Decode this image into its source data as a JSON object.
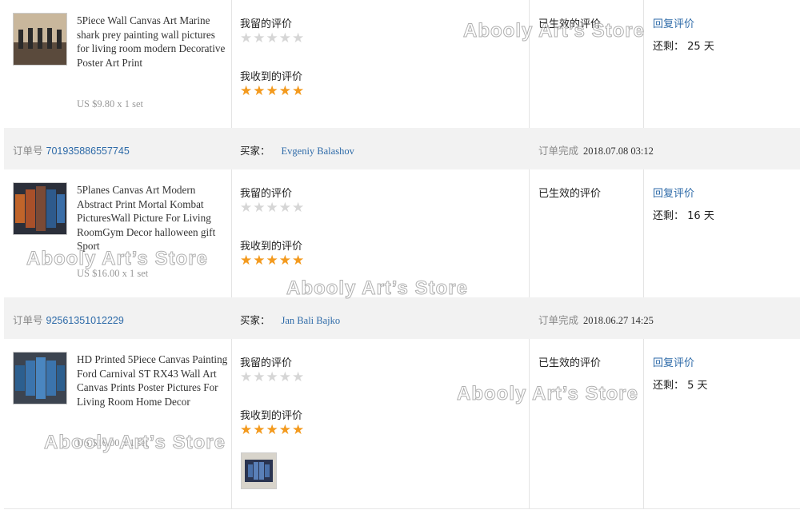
{
  "items": [
    {
      "title": "5Piece Wall Canvas Art Marine shark prey painting wall pictures for living room modern Decorative Poster Art Print",
      "price": "US $9.80 x 1 set",
      "my_review_label": "我留的评价",
      "my_stars": 0,
      "received_review_label": "我收到的评价",
      "received_stars": 5,
      "effective_label": "已生效的评价",
      "reply_label": "回复评价",
      "remaining_label": "还剩：",
      "remaining_value": "25 天"
    },
    {
      "title": "5Planes Canvas Art Modern Abstract Print Mortal Kombat PicturesWall Picture For Living RoomGym Decor halloween gift Sport",
      "price": "US $16.00 x 1 set",
      "my_review_label": "我留的评价",
      "my_stars": 0,
      "received_review_label": "我收到的评价",
      "received_stars": 5,
      "effective_label": "已生效的评价",
      "reply_label": "回复评价",
      "remaining_label": "还剩：",
      "remaining_value": "16 天"
    },
    {
      "title": "HD Printed 5Piece Canvas Painting Ford Carnival ST RX43 Wall Art Canvas Prints Poster Pictures For Living Room Home Decor",
      "price": "US $16.00 x 1 set",
      "my_review_label": "我留的评价",
      "my_stars": 0,
      "received_review_label": "我收到的评价",
      "received_stars": 5,
      "effective_label": "已生效的评价",
      "reply_label": "回复评价",
      "remaining_label": "还剩：",
      "remaining_value": "5 天"
    }
  ],
  "orders": [
    {
      "order_label": "订单号",
      "order_number": "701935886557745",
      "buyer_label": "买家：",
      "buyer_name": "Evgeniy Balashov",
      "completed_label": "订单完成",
      "completed_time": "2018.07.08 03:12"
    },
    {
      "order_label": "订单号",
      "order_number": "92561351012229",
      "buyer_label": "买家：",
      "buyer_name": "Jan Bali Bajko",
      "completed_label": "订单完成",
      "completed_time": "2018.06.27 14:25"
    }
  ],
  "watermark_text": "Abooly Art’s Store",
  "colors": {
    "link": "#2d6aa8",
    "star": "#f39a1e",
    "star_empty": "#d6d6d6",
    "order_bg": "#f2f2f2"
  },
  "star_glyph": "★★★★★"
}
